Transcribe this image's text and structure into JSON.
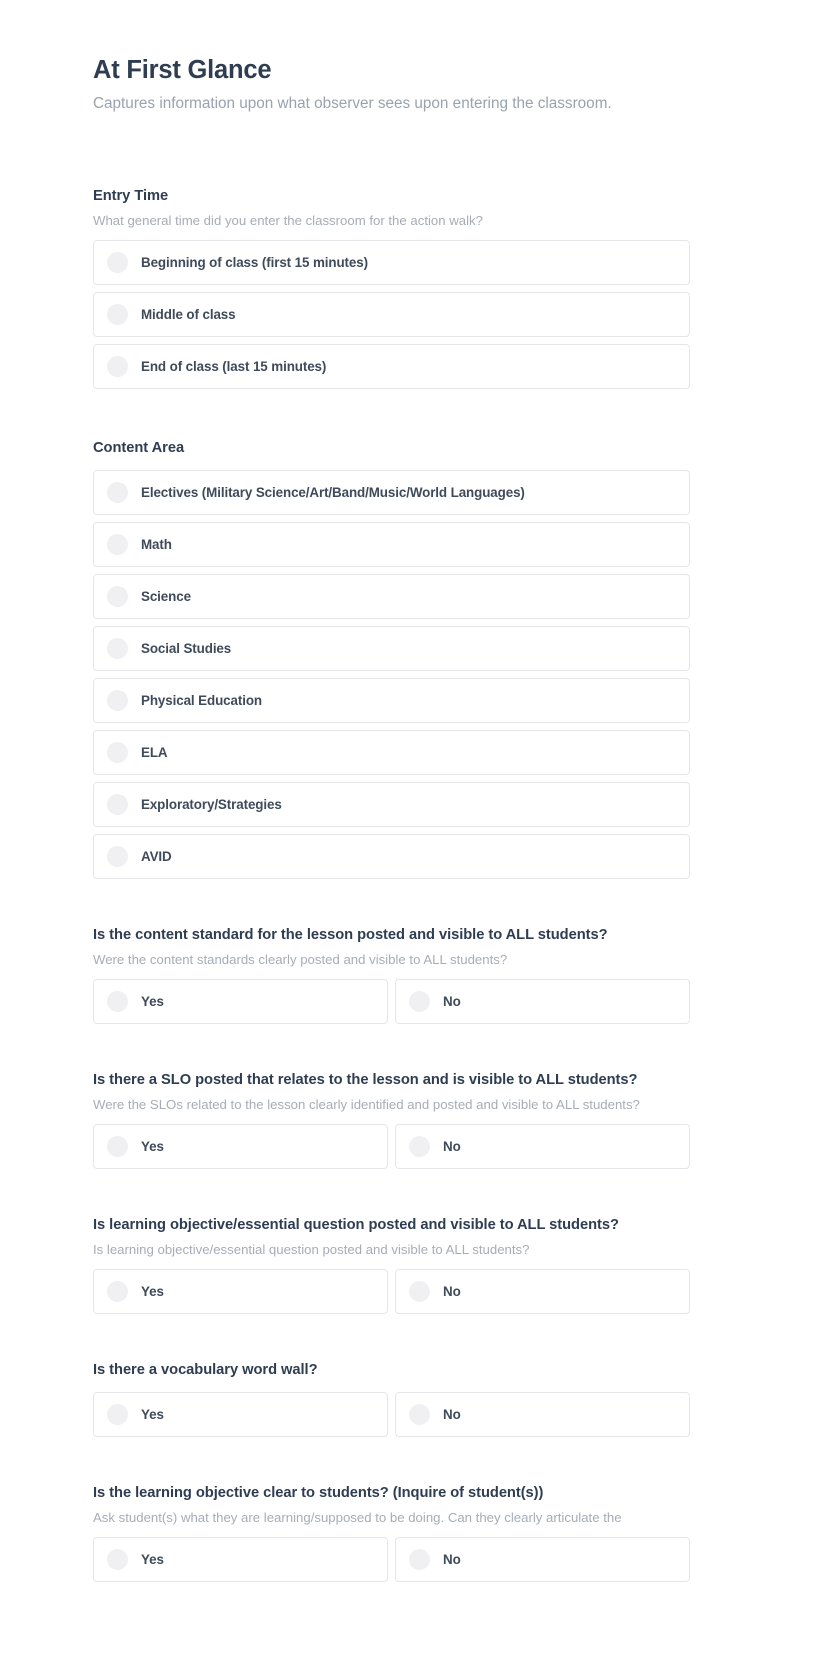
{
  "header": {
    "title": "At First Glance",
    "subtitle": "Captures information upon what observer sees upon entering the classroom."
  },
  "colors": {
    "heading": "#2f3d52",
    "muted": "#9aa2ad",
    "label": "#3f4a5a",
    "card_border": "#e4e6e9",
    "radio_fill": "#f0f0f2",
    "background": "#ffffff"
  },
  "questions": [
    {
      "id": "entry-time",
      "title": "Entry Time",
      "help": "What general time did you enter the classroom for the action walk?",
      "type": "radio-list",
      "options": [
        "Beginning of class (first 15 minutes)",
        "Middle of class",
        "End of class (last 15 minutes)"
      ]
    },
    {
      "id": "content-area",
      "title": "Content Area",
      "help": "",
      "type": "radio-list",
      "options": [
        "Electives (Military Science/Art/Band/Music/World Languages)",
        "Math",
        "Science",
        "Social Studies",
        "Physical Education",
        "ELA",
        "Exploratory/Strategies",
        "AVID"
      ]
    },
    {
      "id": "content-standard-posted",
      "title": "Is the content standard for the lesson posted and visible to ALL students?",
      "help": "Were the content standards clearly posted and visible to ALL students?",
      "type": "yes-no",
      "options": [
        "Yes",
        "No"
      ]
    },
    {
      "id": "slo-posted",
      "title": "Is there a SLO posted that relates to the lesson and is visible to ALL students?",
      "help": "Were the SLOs related to the lesson clearly identified and posted and visible to ALL students?",
      "type": "yes-no",
      "options": [
        "Yes",
        "No"
      ]
    },
    {
      "id": "learning-objective-posted",
      "title": "Is learning objective/essential question posted and visible to ALL students?",
      "help": "Is learning objective/essential question posted and visible to ALL students?",
      "type": "yes-no",
      "options": [
        "Yes",
        "No"
      ]
    },
    {
      "id": "vocabulary-word-wall",
      "title": "Is there a vocabulary word wall?",
      "help": "",
      "type": "yes-no",
      "options": [
        "Yes",
        "No"
      ]
    },
    {
      "id": "learning-objective-clear",
      "title": "Is the learning objective clear to students? (Inquire of student(s))",
      "help": "Ask student(s) what they are learning/supposed to be doing. Can they clearly articulate the",
      "type": "yes-no",
      "options": [
        "Yes",
        "No"
      ]
    }
  ]
}
